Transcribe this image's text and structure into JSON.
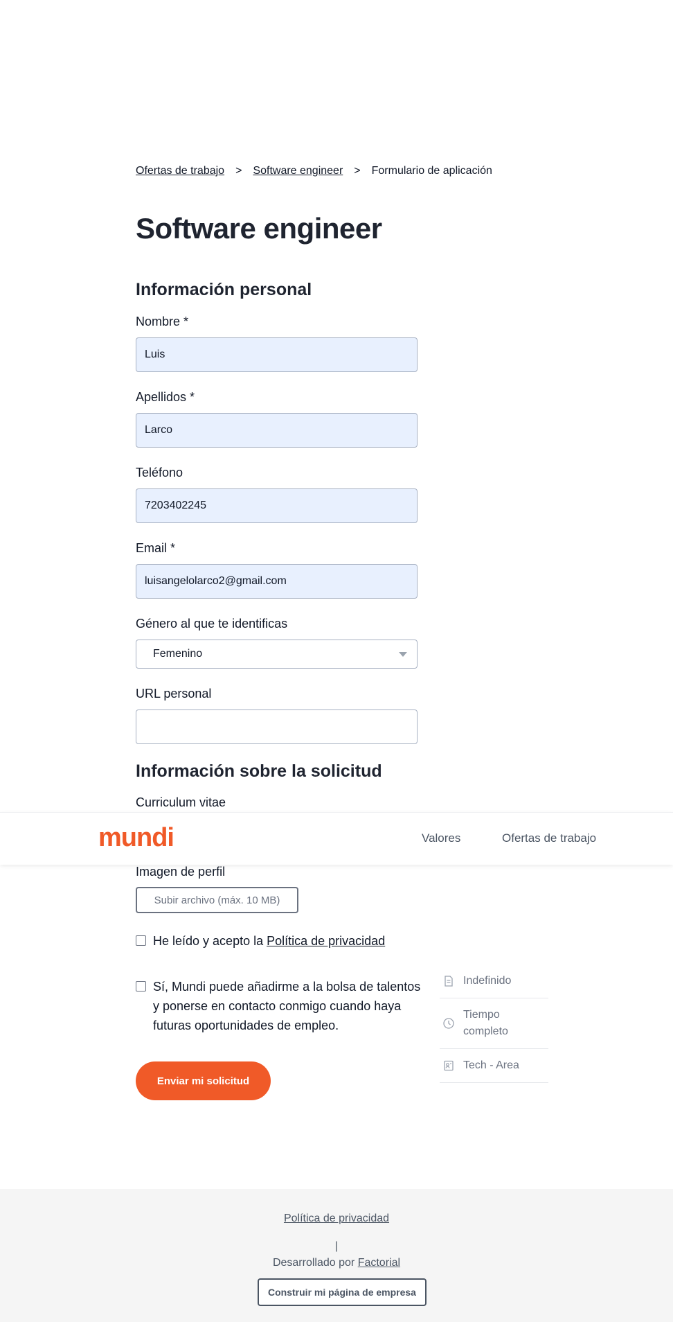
{
  "breadcrumb": {
    "items": [
      "Ofertas de trabajo",
      "Software engineer"
    ],
    "separator": ">",
    "current": "Formulario de aplicación"
  },
  "page": {
    "title": "Software engineer"
  },
  "sections": {
    "personal": "Información personal",
    "application": "Información sobre la solicitud"
  },
  "form": {
    "nombre": {
      "label": "Nombre *",
      "value": "Luis"
    },
    "apellidos": {
      "label": "Apellidos *",
      "value": "Larco"
    },
    "telefono": {
      "label": "Teléfono",
      "value": "7203402245"
    },
    "email": {
      "label": "Email *",
      "value": "luisangelolarco2@gmail.com"
    },
    "genero": {
      "label": "Género al que te identificas",
      "value": "Femenino"
    },
    "url": {
      "label": "URL personal",
      "value": ""
    },
    "cv": {
      "label": "Curriculum vitae"
    },
    "imagen": {
      "label": "Imagen de perfil",
      "button": "Subir archivo (máx. 10 MB)"
    },
    "privacy_check": {
      "text": "He leído y acepto la ",
      "link": "Política de privacidad"
    },
    "talent_check": {
      "lines": [
        "Sí, Mundi puede añadirme a la bolsa de talentos",
        "y ponerse en contacto conmigo cuando haya",
        "futuras oportunidades de empleo."
      ]
    },
    "submit": "Enviar mi solicitud"
  },
  "navbar": {
    "brand": "mundi",
    "links": [
      "Valores",
      "Ofertas de trabajo"
    ]
  },
  "job_meta": {
    "duration": "Indefinido",
    "schedule_lines": [
      "Tiempo",
      "completo"
    ],
    "area": "Tech - Area"
  },
  "footer": {
    "privacy": "Política de privacidad",
    "separator": "|",
    "developed_by": "Desarrollado por ",
    "developer": "Factorial",
    "build_button": "Construir mi página de empresa"
  },
  "colors": {
    "accent": "#f05a28",
    "autofill_bg": "#e8f0fe"
  }
}
